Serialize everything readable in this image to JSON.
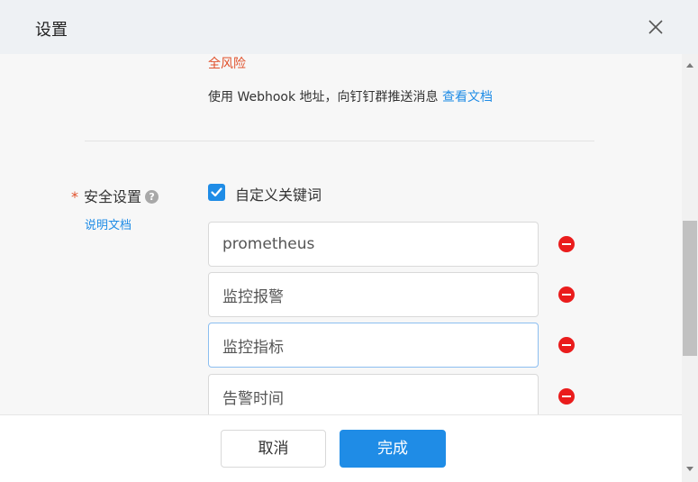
{
  "header": {
    "title": "设置",
    "close_icon": "close-icon"
  },
  "security_note": {
    "risk_text": "全风险",
    "webhook_text": "使用 Webhook 地址，向钉钉群推送消息",
    "webhook_link": "查看文档"
  },
  "security_settings": {
    "required_mark": "*",
    "label": "安全设置",
    "help_icon_glyph": "?",
    "doc_link": "说明文档",
    "checkbox_label": "自定义关键词",
    "checkbox_checked": true,
    "keywords": [
      {
        "value": "prometheus"
      },
      {
        "value": "监控报警"
      },
      {
        "value": "监控指标"
      },
      {
        "value": "告警时间"
      }
    ]
  },
  "footer": {
    "cancel_label": "取消",
    "done_label": "完成"
  },
  "colors": {
    "accent": "#1f8ce6",
    "danger": "#ea1c1c",
    "warning_text": "#e0502a",
    "header_bg": "#eef1f4",
    "body_bg": "#f7f7f7"
  }
}
